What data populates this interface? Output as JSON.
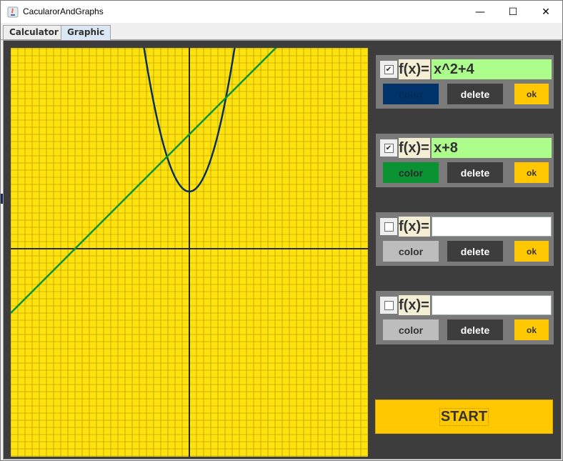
{
  "window": {
    "title": "CacularorAndGraphs",
    "controls": {
      "minimize": "—",
      "maximize": "☐",
      "close": "✕"
    }
  },
  "tabs": [
    {
      "label": "Calculator",
      "active": false
    },
    {
      "label": "Graphic",
      "active": true
    }
  ],
  "graph": {
    "background_color": "#ffe20e",
    "grid_color": "#a08a00",
    "axis_color": "#2a2a2a",
    "functions_plotted": [
      {
        "expression": "x^2+4",
        "color": "#0a2f63"
      },
      {
        "expression": "x+8",
        "color": "#0b9333"
      }
    ]
  },
  "functions": [
    {
      "checked": true,
      "check_glyph": "✔",
      "label": "f(x)=",
      "value": "x^2+4",
      "color_button": {
        "label": "color",
        "bg": "#00336a",
        "fg": "#0a2a55"
      },
      "delete_label": "delete",
      "ok_label": "ok"
    },
    {
      "checked": true,
      "check_glyph": "✔",
      "label": "f(x)=",
      "value": "x+8",
      "color_button": {
        "label": "color",
        "bg": "#0b9333",
        "fg": "#2b2b2b"
      },
      "delete_label": "delete",
      "ok_label": "ok"
    },
    {
      "checked": false,
      "check_glyph": "",
      "label": "f(x)=",
      "value": "",
      "color_button": {
        "label": "color",
        "bg": "#bdbdbd",
        "fg": "#333333"
      },
      "delete_label": "delete",
      "ok_label": "ok"
    },
    {
      "checked": false,
      "check_glyph": "",
      "label": "f(x)=",
      "value": "",
      "color_button": {
        "label": "color",
        "bg": "#bdbdbd",
        "fg": "#333333"
      },
      "delete_label": "delete",
      "ok_label": "ok"
    }
  ],
  "start_label": "START",
  "colors": {
    "panel_bg": "#3d3d3d",
    "panel_row": "#7a7a7a",
    "accent_yellow": "#ffc800",
    "input_filled": "#adfd8c"
  }
}
